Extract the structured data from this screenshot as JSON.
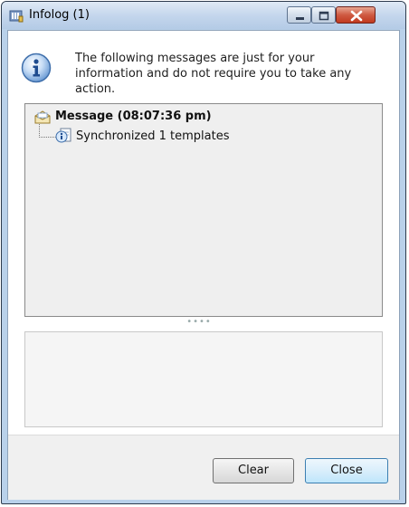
{
  "window": {
    "title": "Infolog (1)",
    "app_icon": "infolog-icon"
  },
  "title_controls": {
    "minimize_icon": "minimize-icon",
    "maximize_icon": "maximize-icon",
    "close_icon": "close-icon"
  },
  "header": {
    "icon": "info-icon",
    "text": "The following messages are just for your information and do not require you to take any action."
  },
  "tree": {
    "node": {
      "icon": "message-envelope-icon",
      "label": "Message (08:07:36 pm)"
    },
    "child": {
      "icon": "info-document-icon",
      "label": "Synchronized 1 templates"
    }
  },
  "buttons": {
    "clear": "Clear",
    "close": "Close"
  },
  "colors": {
    "title_bar": "#c2d5ec",
    "tree_bg": "#efefef",
    "footer_bg": "#f0f0f0",
    "close_button_red": "#c13a20",
    "default_button_blue": "#bee6fb"
  }
}
